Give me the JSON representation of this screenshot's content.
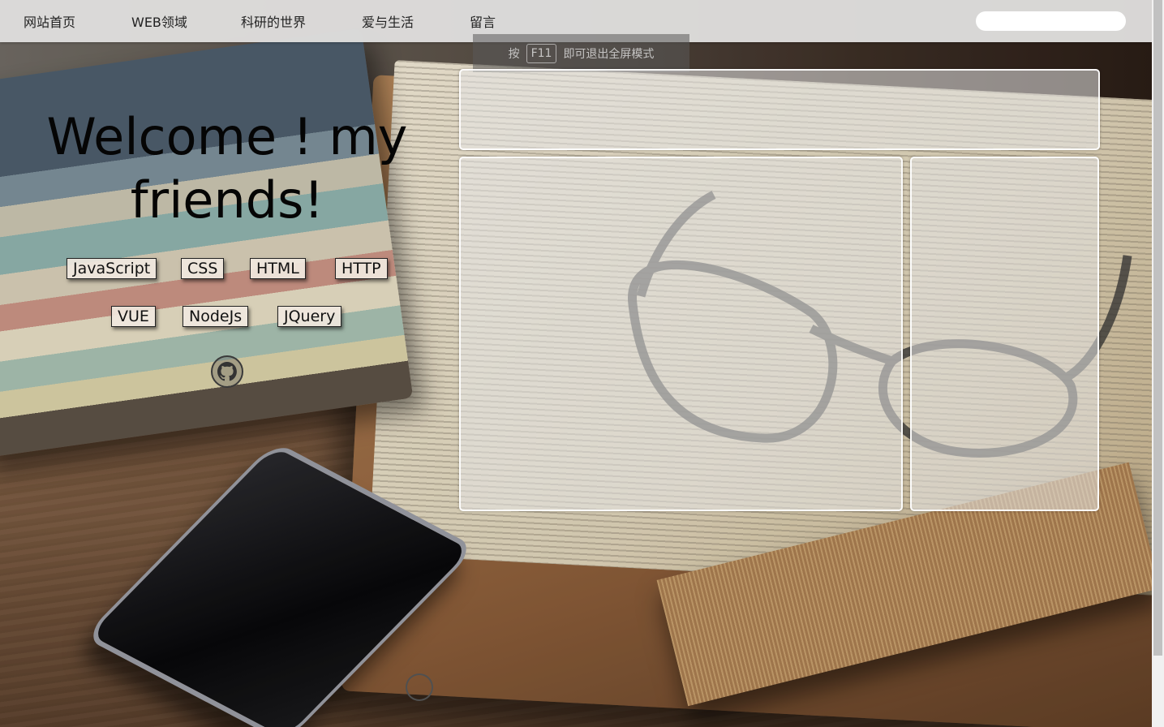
{
  "nav": {
    "items": [
      {
        "label": "网站首页"
      },
      {
        "label": "WEB领域"
      },
      {
        "label": "科研的世界"
      },
      {
        "label": "爱与生活"
      },
      {
        "label": "留言"
      }
    ],
    "search_value": ""
  },
  "fullscreen_hint": {
    "prefix": "按",
    "key": "F11",
    "suffix": "即可退出全屏模式"
  },
  "hero": {
    "title_line1": "Welcome ! my",
    "title_line2": "friends!"
  },
  "tags": [
    "JavaScript",
    "CSS",
    "HTML",
    "HTTP",
    "VUE",
    "NodeJs",
    "JQuery"
  ],
  "icons": {
    "github": "github-icon"
  },
  "colors": {
    "navbar": "#dedddc",
    "panel_border": "#ffffff",
    "title": "#050505"
  }
}
